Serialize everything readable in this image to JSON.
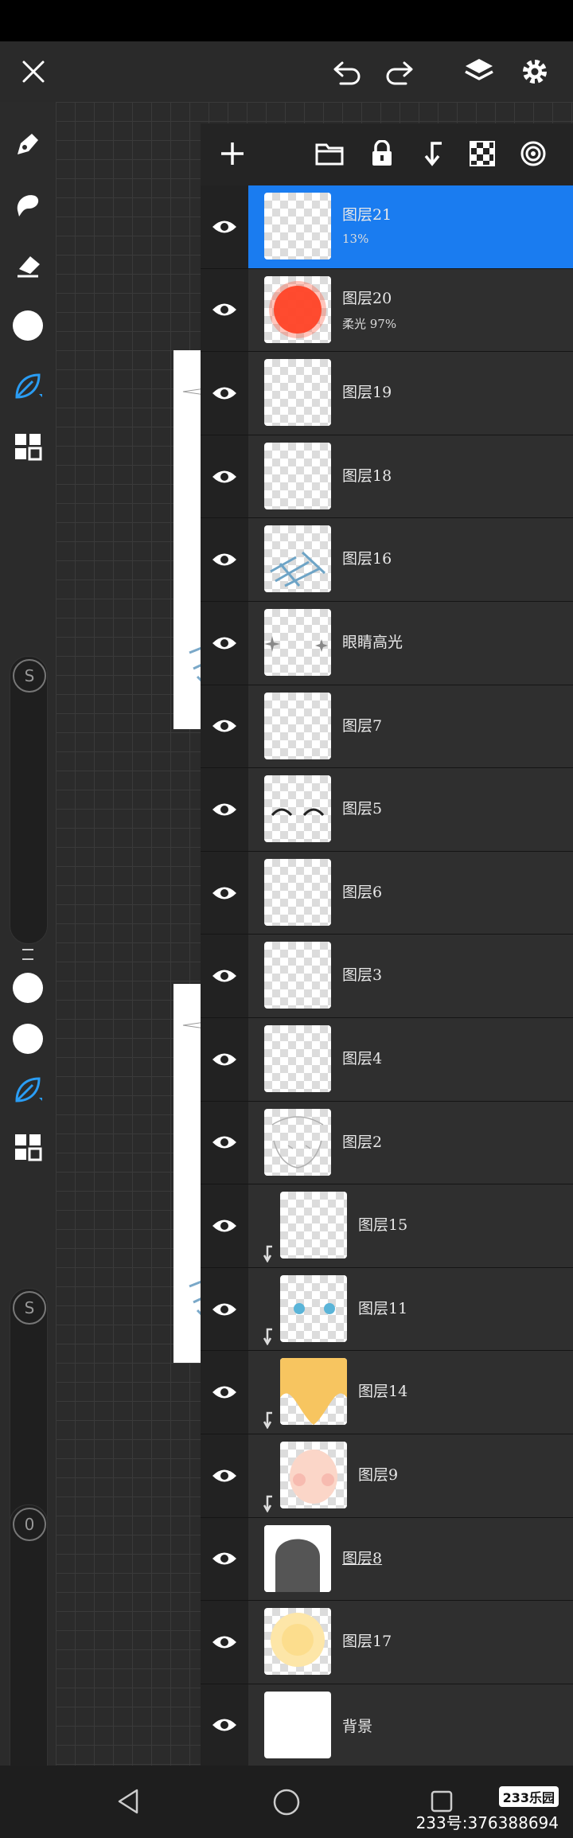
{
  "layers": [
    {
      "name": "图层21",
      "sub": "13%",
      "selected": true,
      "thumb": "checker",
      "clip": false
    },
    {
      "name": "图层20",
      "sub": "柔光  97%",
      "selected": false,
      "thumb": "red-blob",
      "clip": false
    },
    {
      "name": "图层19",
      "sub": "",
      "selected": false,
      "thumb": "checker",
      "clip": false
    },
    {
      "name": "图层18",
      "sub": "",
      "selected": false,
      "thumb": "checker",
      "clip": false
    },
    {
      "name": "图层16",
      "sub": "",
      "selected": false,
      "thumb": "blue-scribble",
      "clip": false
    },
    {
      "name": "眼睛高光",
      "sub": "",
      "selected": false,
      "thumb": "sparkle",
      "clip": false
    },
    {
      "name": "图层7",
      "sub": "",
      "selected": false,
      "thumb": "checker",
      "clip": false
    },
    {
      "name": "图层5",
      "sub": "",
      "selected": false,
      "thumb": "eyes-line",
      "clip": false
    },
    {
      "name": "图层6",
      "sub": "",
      "selected": false,
      "thumb": "checker",
      "clip": false
    },
    {
      "name": "图层3",
      "sub": "",
      "selected": false,
      "thumb": "checker",
      "clip": false
    },
    {
      "name": "图层4",
      "sub": "",
      "selected": false,
      "thumb": "checker",
      "clip": false
    },
    {
      "name": "图层2",
      "sub": "",
      "selected": false,
      "thumb": "sketch",
      "clip": false
    },
    {
      "name": "图层15",
      "sub": "",
      "selected": false,
      "thumb": "checker",
      "clip": true
    },
    {
      "name": "图层11",
      "sub": "",
      "selected": false,
      "thumb": "blue-eyes",
      "clip": true
    },
    {
      "name": "图层14",
      "sub": "",
      "selected": false,
      "thumb": "hair",
      "clip": true
    },
    {
      "name": "图层9",
      "sub": "",
      "selected": false,
      "thumb": "skin",
      "clip": true
    },
    {
      "name": "图层8",
      "sub": "",
      "selected": false,
      "thumb": "silhouette",
      "clip": false,
      "underline": true
    },
    {
      "name": "图层17",
      "sub": "",
      "selected": false,
      "thumb": "yellow-glow",
      "clip": false
    },
    {
      "name": "背景",
      "sub": "",
      "selected": false,
      "thumb": "white",
      "clip": false
    }
  ],
  "icons": {
    "close": "close-icon",
    "undo": "undo-icon",
    "redo": "redo-icon",
    "layers": "layers-icon",
    "settings": "gear-icon",
    "add": "plus-icon",
    "folder": "folder-icon",
    "lock": "lock-icon",
    "clip": "clip-arrow-icon",
    "alpha": "checker-icon",
    "blend": "blend-target-icon"
  },
  "toolbar": {
    "slider_label_1": "S",
    "slider_label_2": "S",
    "slider_label_3": "0"
  },
  "watermark": {
    "logo": "233乐园",
    "text": "233号:376388694"
  },
  "colors": {
    "accent": "#1a7cf0",
    "panel": "#222222",
    "row": "#2f2f2f",
    "brush_icon": "#2a9df4"
  }
}
